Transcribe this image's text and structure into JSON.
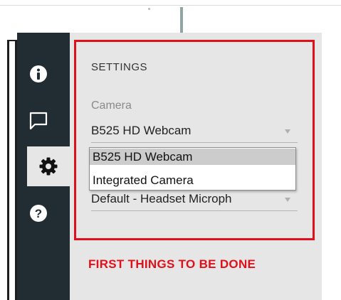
{
  "panel": {
    "title": "SETTINGS",
    "camera": {
      "label": "Camera",
      "selected": "B525 HD Webcam",
      "options": [
        "B525 HD Webcam",
        "Integrated Camera"
      ]
    },
    "microphone": {
      "selected": "Default - Headset Microph"
    }
  },
  "rail": {
    "items": [
      {
        "icon": "info-icon"
      },
      {
        "icon": "chat-icon"
      },
      {
        "icon": "gear-icon",
        "active": true
      },
      {
        "icon": "help-icon"
      }
    ]
  },
  "annotation": {
    "text": "FIRST THINGS TO BE DONE",
    "color": "#e0101a"
  },
  "colors": {
    "rail_bg": "#222d33",
    "panel_bg": "#e6e6e6",
    "highlight": "#e0101a"
  }
}
